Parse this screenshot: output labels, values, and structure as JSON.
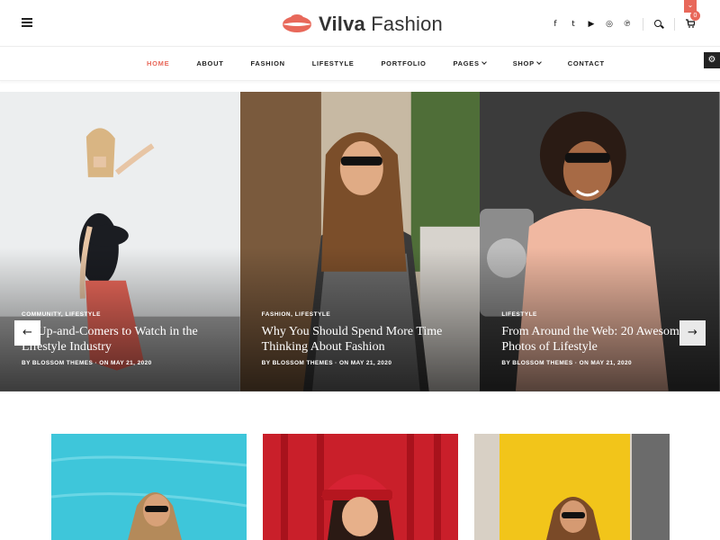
{
  "header": {
    "logo_bold": "Vilva",
    "logo_rest": " Fashion",
    "social_icons": [
      "facebook-icon",
      "twitter-icon",
      "youtube-icon",
      "instagram-icon",
      "pinterest-icon"
    ],
    "social_glyphs": [
      "f",
      "t",
      "▶",
      "◎",
      "℗"
    ],
    "cart_count": "0",
    "brand_color": "#e8685a"
  },
  "nav": {
    "items": [
      {
        "label": "HOME",
        "active": true
      },
      {
        "label": "ABOUT"
      },
      {
        "label": "FASHION"
      },
      {
        "label": "LIFESTYLE"
      },
      {
        "label": "PORTFOLIO"
      },
      {
        "label": "PAGES"
      },
      {
        "label": "SHOP"
      },
      {
        "label": "CONTACT"
      }
    ]
  },
  "slides": [
    {
      "categories": [
        "COMMUNITY",
        "LIFESTYLE"
      ],
      "title": "20 Up-and-Comers to Watch in the Lifestyle Industry",
      "author": "BY BLOSSOM THEMES",
      "date": "ON MAY 21, 2020"
    },
    {
      "categories": [
        "FASHION",
        "LIFESTYLE"
      ],
      "title": "Why You Should Spend More Time Thinking About Fashion",
      "author": "BY BLOSSOM THEMES",
      "date": "ON MAY 21, 2020"
    },
    {
      "categories": [
        "LIFESTYLE"
      ],
      "title": "From Around the Web: 20 Awesome Photos of Lifestyle",
      "author": "BY BLOSSOM THEMES",
      "date": "ON MAY 21, 2020"
    }
  ],
  "arrows": {
    "prev": "←",
    "next": "→"
  }
}
